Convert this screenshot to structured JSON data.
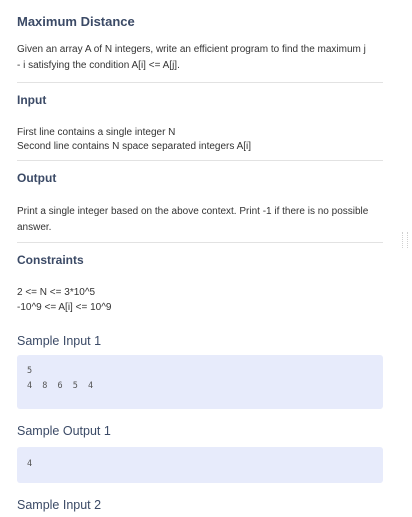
{
  "problem": {
    "title": "Maximum Distance",
    "description": "Given an array A of N integers, write an efficient program to find the maximum j - i satisfying the condition A[i] <= A[j]."
  },
  "input": {
    "heading": "Input",
    "lines": [
      "First line contains a single integer N",
      "Second line contains N space separated integers A[i]"
    ]
  },
  "output": {
    "heading": "Output",
    "text": "Print a single integer based on the above context. Print -1 if there is no possible answer."
  },
  "constraints": {
    "heading": "Constraints",
    "lines": [
      "2 <= N <= 3*10^5",
      "-10^9 <= A[i] <= 10^9"
    ]
  },
  "samples": [
    {
      "heading": "Sample Input 1",
      "lines": [
        "5",
        "4 8 6 5 4"
      ]
    },
    {
      "heading": "Sample Output 1",
      "lines": [
        "4"
      ]
    },
    {
      "heading": "Sample Input 2"
    }
  ]
}
